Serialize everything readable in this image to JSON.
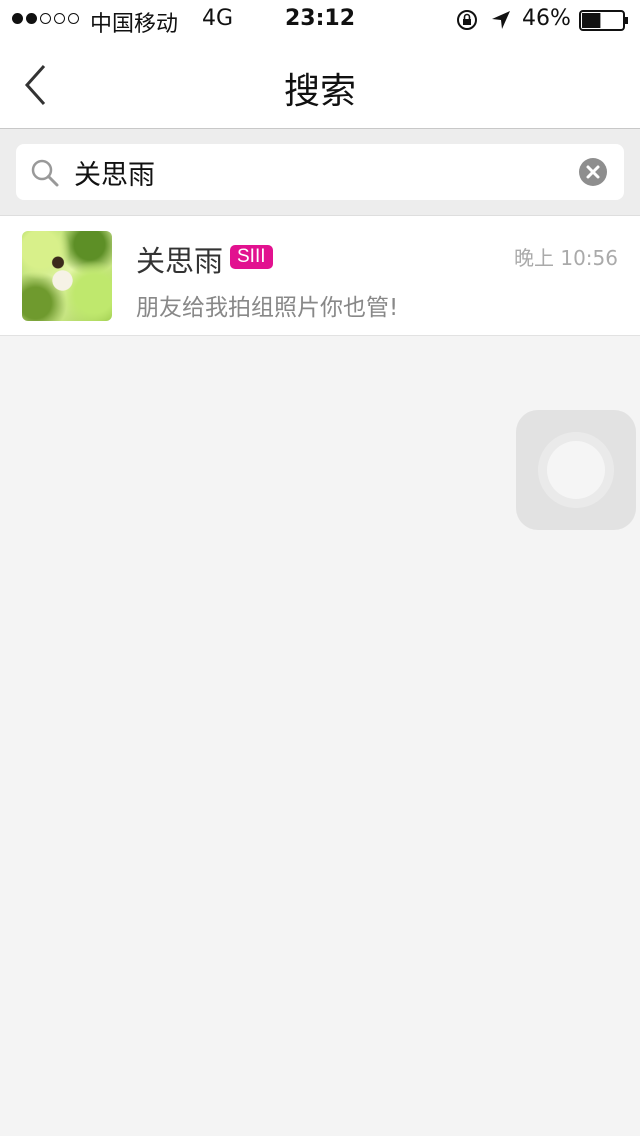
{
  "status_bar": {
    "signal_dots_on": 2,
    "signal_dots_total": 5,
    "carrier": "中国移动",
    "network": "4G",
    "time": "23:12",
    "battery_percent": "46%",
    "battery_level": 0.46,
    "icons": [
      "signal-icon",
      "lock-rotation-icon",
      "location-icon",
      "battery-icon"
    ]
  },
  "nav": {
    "title": "搜索",
    "back_icon": "chevron-left-icon"
  },
  "search": {
    "value": "关思雨",
    "placeholder": "",
    "icon": "search-icon",
    "clear_icon": "clear-icon"
  },
  "results": [
    {
      "name": "关思雨",
      "badge": "SIII",
      "time": "晚上 10:56",
      "message": "朋友给我拍组照片你也管!"
    }
  ],
  "colors": {
    "badge": "#e2118f",
    "background": "#f4f4f4",
    "navbar": "#ffffff"
  }
}
